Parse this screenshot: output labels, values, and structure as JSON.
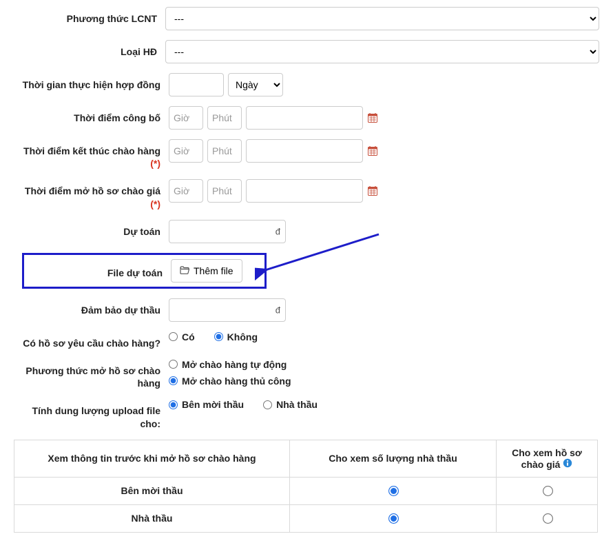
{
  "labels": {
    "lcnt": "Phương thức LCNT",
    "loaihd": "Loại HĐ",
    "thoigian": "Thời gian thực hiện hợp đồng",
    "congbo": "Thời điểm công bố",
    "ketthuc": "Thời điểm kết thúc chào hàng",
    "mohoso": "Thời điểm mở hồ sơ chào giá",
    "dutoan": "Dự toán",
    "filedutoan": "File dự toán",
    "dambao": "Đảm bảo dự thầu",
    "coho": "Có hồ sơ yêu cầu chào hàng?",
    "phuongthucmo": "Phương thức mở hồ sơ chào hàng",
    "tinhfile": "Tính dung lượng upload file cho:"
  },
  "req": "(*)",
  "select_default": "---",
  "unit_default": "Ngày",
  "placeholders": {
    "hour": "Giờ",
    "minute": "Phút"
  },
  "currency_unit": "đ",
  "addfile_label": "Thêm file",
  "radios": {
    "co": "Có",
    "khong": "Không",
    "mo_auto": "Mở chào hàng tự động",
    "mo_manual": "Mở chào hàng thủ công",
    "benmoithau": "Bên mời thầu",
    "nhathau": "Nhà thầu"
  },
  "table": {
    "col1": "Xem thông tin trước khi mở hồ sơ chào hàng",
    "col2": "Cho xem số lượng nhà thầu",
    "col3": "Cho xem hồ sơ chào giá",
    "row1": "Bên mời thầu",
    "row2": "Nhà thầu"
  }
}
